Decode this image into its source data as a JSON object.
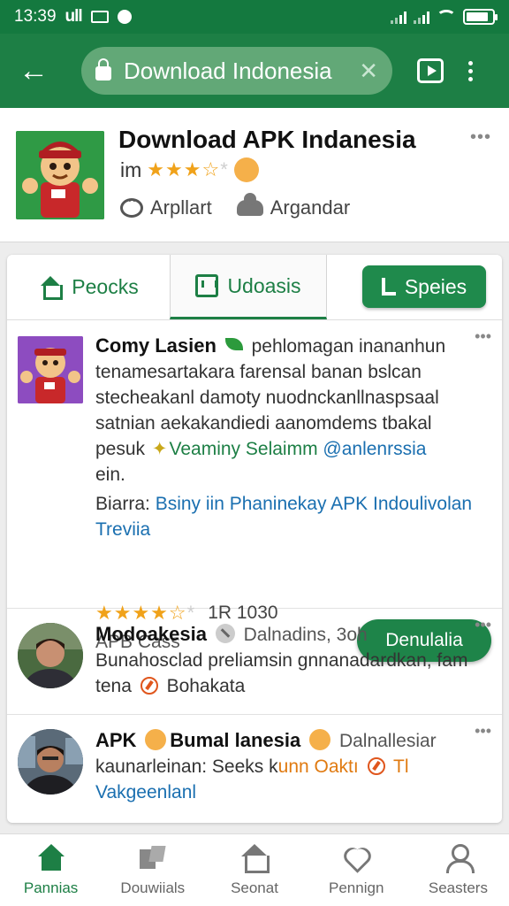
{
  "status_bar": {
    "time": "13:39",
    "signal_text": "ull",
    "battery_level": 0.85
  },
  "app_bar": {
    "url_text": "Download Indonesia",
    "clear_symbol": "✕",
    "back_symbol": "←"
  },
  "header": {
    "title": "Download APK Indanesia",
    "rating_prefix": "im",
    "stars_full": "★★★",
    "stars_half": "☆",
    "stars_empty": "*",
    "meta1": "Arpllart",
    "meta2": "Argandar",
    "more": "•••"
  },
  "tabs": [
    {
      "label": "Peocks"
    },
    {
      "label": "Udoasis"
    },
    {
      "label": "Speies"
    }
  ],
  "posts": [
    {
      "name": "Comy Lasien",
      "line1_after_icon": "pehlomagan inananhun",
      "line2": "tenamesartakara farensal banan bslcan",
      "line3": "stecheakanl damoty nuodnckanllnaspsaal",
      "line4": "satnian aekakandiedi aanomdems tbakal",
      "line5_start": "pesuk",
      "line5_link": "Veaminy Selaimm",
      "line5_link2": "@anlenrssia",
      "line6": "ein.",
      "meta_label": "Biarra:",
      "meta_link": "Bsiny iin Phaninekay APK Indoulivolan Treviia",
      "stars_full": "★★★★",
      "stars_half": "☆",
      "stars_empty": "*",
      "count": "1R 1030",
      "sub": "APB Cass",
      "button": "Denulalia",
      "more": "•••"
    },
    {
      "name": "Modoakesia",
      "time": "Dalnadins, 3oh",
      "text": "Bunahosclad preliamsin gnnanadardkan, fam",
      "text2_start": "tena",
      "text2_end": "Bohakata",
      "more": "•••"
    },
    {
      "name": "APK",
      "name2": "Bumal lanesia",
      "name3": "Dalnallesiar",
      "text_start": "kaunarleinan: Seeks k",
      "text_orange": "unn Oaktı",
      "text_orange2": "Tl",
      "text_link": "Vakgeenlanl",
      "more": "•••"
    }
  ],
  "bottom_nav": [
    {
      "label": "Pannias"
    },
    {
      "label": "Douwiials"
    },
    {
      "label": "Seonat"
    },
    {
      "label": "Pennign"
    },
    {
      "label": "Seasters"
    }
  ],
  "colors": {
    "brand_green": "#1d7f45",
    "status_green": "#14793f",
    "star": "#f0a21a",
    "link": "#1a6fb0"
  }
}
